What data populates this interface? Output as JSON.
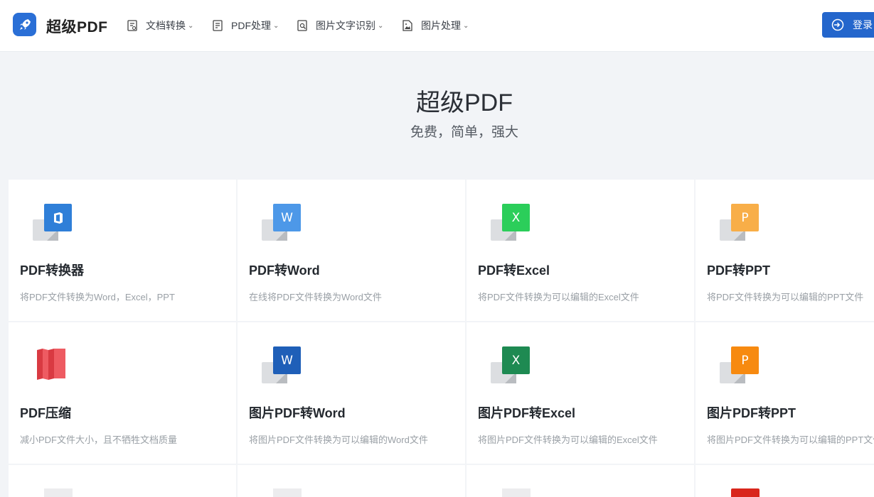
{
  "header": {
    "logo_text": "超级PDF",
    "nav": [
      {
        "label": "文档转换",
        "icon": "document-convert-icon"
      },
      {
        "label": "PDF处理",
        "icon": "pdf-process-icon"
      },
      {
        "label": "图片文字识别",
        "icon": "ocr-search-icon"
      },
      {
        "label": "图片处理",
        "icon": "image-file-icon"
      }
    ],
    "login_label": "登录"
  },
  "hero": {
    "title": "超级PDF",
    "subtitle": "免费，简单，强大"
  },
  "tools": [
    {
      "title": "PDF转换器",
      "desc": "将PDF文件转换为Word，Excel，PPT",
      "icon": "office-icon",
      "color": "#2f7fd8",
      "glyph": ""
    },
    {
      "title": "PDF转Word",
      "desc": "在线将PDF文件转换为Word文件",
      "icon": "word-icon",
      "color": "#4d98e8",
      "glyph": "W"
    },
    {
      "title": "PDF转Excel",
      "desc": "将PDF文件转换为可以编辑的Excel文件",
      "icon": "excel-icon",
      "color": "#2bce5a",
      "glyph": "X"
    },
    {
      "title": "PDF转PPT",
      "desc": "将PDF文件转换为可以编辑的PPT文件",
      "icon": "ppt-icon",
      "color": "#f8ae48",
      "glyph": "P"
    },
    {
      "title": "PDF压缩",
      "desc": "减小PDF文件大小，且不牺牲文档质量",
      "icon": "compress-icon",
      "color": "#e8484f",
      "glyph": ""
    },
    {
      "title": "图片PDF转Word",
      "desc": "将图片PDF文件转换为可以编辑的Word文件",
      "icon": "word-icon",
      "color": "#1f5fb8",
      "glyph": "W"
    },
    {
      "title": "图片PDF转Excel",
      "desc": "将图片PDF文件转换为可以编辑的Excel文件",
      "icon": "excel-icon",
      "color": "#1e8a52",
      "glyph": "X"
    },
    {
      "title": "图片PDF转PPT",
      "desc": "将图片PDF文件转换为可以编辑的PPT文件",
      "icon": "ppt-icon",
      "color": "#f78a10",
      "glyph": "P"
    }
  ]
}
